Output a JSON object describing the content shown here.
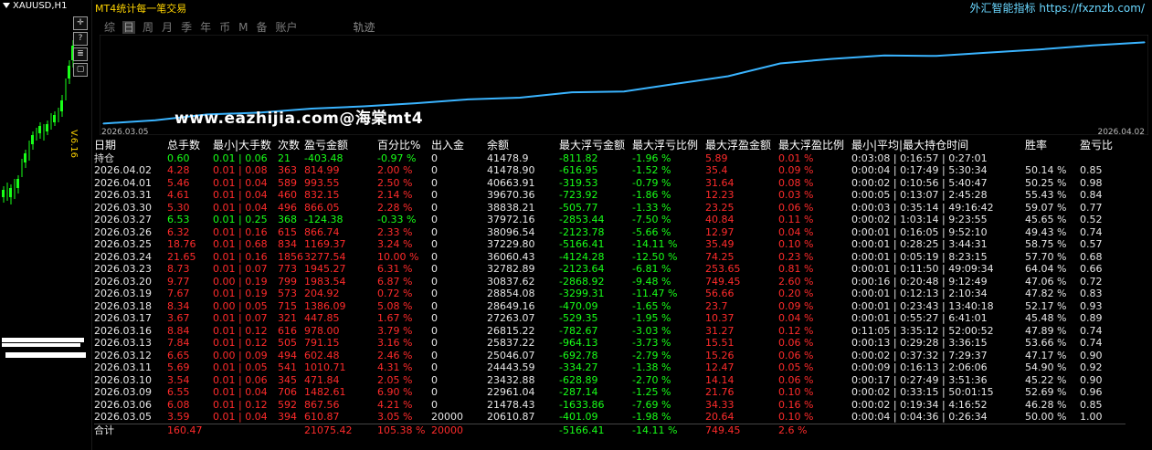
{
  "mt4": {
    "symbol": "XAUUSD,H1",
    "price_label": "V.6.16",
    "tool_icons": [
      "crosshair-icon",
      "help-icon",
      "settings-icon",
      "window-icon"
    ]
  },
  "panel": {
    "title": "MT4统计每一笔交易",
    "site": "外汇智能指标 https://fxznzb.com/",
    "tabs": [
      "综",
      "日",
      "周",
      "月",
      "季",
      "年",
      "币",
      "M",
      "备",
      "账户"
    ],
    "active_tab": "日",
    "track_tab": "轨迹",
    "date_start": "2026.03.05",
    "date_end": "2026.04.02",
    "watermark": "www.eazhijia.com@海棠mt4",
    "curve_color": "#3ab4ff"
  },
  "table": {
    "headers": [
      "日期",
      "总手数",
      "最小|大手数",
      "次数",
      "盈亏金额",
      "百分比%",
      "出入金",
      "余额",
      "最大浮亏金额",
      "最大浮亏比例",
      "最大浮盈金额",
      "最大浮盈比例",
      "最小|平均|最大持仓时间",
      "胜率",
      "盈亏比"
    ],
    "holding": [
      "持仓",
      "0.60",
      "0.01 | 0.06",
      "21",
      "-403.48",
      "-0.97 %",
      "0",
      "41478.9",
      "-811.82",
      "-1.96 %",
      "5.89",
      "0.01 %",
      "0:03:08 | 0:16:57 | 0:27:01",
      "",
      ""
    ],
    "rows": [
      [
        "2026.04.02",
        "4.28",
        "0.01 | 0.08",
        "363",
        "814.99",
        "2.00 %",
        "0",
        "41478.90",
        "-616.95",
        "-1.52 %",
        "35.4",
        "0.09 %",
        "0:00:04 | 0:17:49 | 5:30:34",
        "50.14 %",
        "0.85"
      ],
      [
        "2026.04.01",
        "5.46",
        "0.01 | 0.04",
        "589",
        "993.55",
        "2.50 %",
        "0",
        "40663.91",
        "-319.53",
        "-0.79 %",
        "31.64",
        "0.08 %",
        "0:00:02 | 0:10:56 | 5:40:47",
        "50.25 %",
        "0.98"
      ],
      [
        "2026.03.31",
        "4.61",
        "0.01 | 0.04",
        "460",
        "832.15",
        "2.14 %",
        "0",
        "39670.36",
        "-723.92",
        "-1.86 %",
        "12.23",
        "0.03 %",
        "0:00:05 | 0:13:07 | 2:45:28",
        "55.43 %",
        "0.84"
      ],
      [
        "2026.03.30",
        "5.30",
        "0.01 | 0.04",
        "496",
        "866.05",
        "2.28 %",
        "0",
        "38838.21",
        "-505.77",
        "-1.33 %",
        "23.25",
        "0.06 %",
        "0:00:03 | 0:35:14 | 49:16:42",
        "59.07 %",
        "0.77"
      ],
      [
        "2026.03.27",
        "6.53",
        "0.01 | 0.25",
        "368",
        "-124.38",
        "-0.33 %",
        "0",
        "37972.16",
        "-2853.44",
        "-7.50 %",
        "40.84",
        "0.11 %",
        "0:00:02 | 1:03:14 | 9:23:55",
        "45.65 %",
        "0.52"
      ],
      [
        "2026.03.26",
        "6.32",
        "0.01 | 0.16",
        "615",
        "866.74",
        "2.33 %",
        "0",
        "38096.54",
        "-2123.78",
        "-5.66 %",
        "12.97",
        "0.04 %",
        "0:00:01 | 0:16:05 | 9:52:10",
        "49.43 %",
        "0.74"
      ],
      [
        "2026.03.25",
        "18.76",
        "0.01 | 0.68",
        "834",
        "1169.37",
        "3.24 %",
        "0",
        "37229.80",
        "-5166.41",
        "-14.11 %",
        "35.49",
        "0.10 %",
        "0:00:01 | 0:28:25 | 3:44:31",
        "58.75 %",
        "0.57"
      ],
      [
        "2026.03.24",
        "21.65",
        "0.01 | 0.16",
        "1856",
        "3277.54",
        "10.00 %",
        "0",
        "36060.43",
        "-4124.28",
        "-12.50 %",
        "74.25",
        "0.23 %",
        "0:00:01 | 0:05:19 | 8:23:15",
        "57.70 %",
        "0.68"
      ],
      [
        "2026.03.23",
        "8.73",
        "0.01 | 0.07",
        "773",
        "1945.27",
        "6.31 %",
        "0",
        "32782.89",
        "-2123.64",
        "-6.81 %",
        "253.65",
        "0.81 %",
        "0:00:01 | 0:11:50 | 49:09:34",
        "64.04 %",
        "0.66"
      ],
      [
        "2026.03.20",
        "9.77",
        "0.00 | 0.19",
        "799",
        "1983.54",
        "6.87 %",
        "0",
        "30837.62",
        "-2868.92",
        "-9.48 %",
        "749.45",
        "2.60 %",
        "0:00:16 | 0:20:48 | 9:12:49",
        "47.06 %",
        "0.72"
      ],
      [
        "2026.03.19",
        "7.67",
        "0.01 | 0.19",
        "573",
        "204.92",
        "0.72 %",
        "0",
        "28854.08",
        "-3299.31",
        "-11.47 %",
        "56.66",
        "0.20 %",
        "0:00:01 | 0:12:13 | 2:10:34",
        "47.82 %",
        "0.83"
      ],
      [
        "2026.03.18",
        "8.34",
        "0.00 | 0.05",
        "715",
        "1386.09",
        "5.08 %",
        "0",
        "28649.16",
        "-470.09",
        "-1.65 %",
        "23.7",
        "0.09 %",
        "0:00:01 | 0:23:43 | 13:40:18",
        "52.17 %",
        "0.93"
      ],
      [
        "2026.03.17",
        "3.67",
        "0.01 | 0.07",
        "321",
        "447.85",
        "1.67 %",
        "0",
        "27263.07",
        "-529.35",
        "-1.95 %",
        "10.37",
        "0.04 %",
        "0:00:01 | 0:55:27 | 6:41:01",
        "45.48 %",
        "0.89"
      ],
      [
        "2026.03.16",
        "8.84",
        "0.01 | 0.12",
        "616",
        "978.00",
        "3.79 %",
        "0",
        "26815.22",
        "-782.67",
        "-3.03 %",
        "31.27",
        "0.12 %",
        "0:11:05 | 3:35:12 | 52:00:52",
        "47.89 %",
        "0.74"
      ],
      [
        "2026.03.13",
        "7.84",
        "0.01 | 0.12",
        "505",
        "791.15",
        "3.16 %",
        "0",
        "25837.22",
        "-964.13",
        "-3.73 %",
        "15.51",
        "0.06 %",
        "0:00:13 | 0:29:28 | 3:36:15",
        "53.66 %",
        "0.74"
      ],
      [
        "2026.03.12",
        "6.65",
        "0.00 | 0.09",
        "494",
        "602.48",
        "2.46 %",
        "0",
        "25046.07",
        "-692.78",
        "-2.79 %",
        "15.26",
        "0.06 %",
        "0:00:02 | 0:37:32 | 7:29:37",
        "47.17 %",
        "0.90"
      ],
      [
        "2026.03.11",
        "5.69",
        "0.01 | 0.05",
        "541",
        "1010.71",
        "4.31 %",
        "0",
        "24443.59",
        "-334.27",
        "-1.38 %",
        "12.47",
        "0.05 %",
        "0:00:09 | 0:16:13 | 2:06:06",
        "54.90 %",
        "0.92"
      ],
      [
        "2026.03.10",
        "3.54",
        "0.01 | 0.06",
        "345",
        "471.84",
        "2.05 %",
        "0",
        "23432.88",
        "-628.89",
        "-2.70 %",
        "14.14",
        "0.06 %",
        "0:00:17 | 0:27:49 | 3:51:36",
        "45.22 %",
        "0.90"
      ],
      [
        "2026.03.09",
        "6.55",
        "0.01 | 0.04",
        "706",
        "1482.61",
        "6.90 %",
        "0",
        "22961.04",
        "-287.14",
        "-1.25 %",
        "21.76",
        "0.10 %",
        "0:00:02 | 0:33:15 | 50:01:15",
        "52.69 %",
        "0.96"
      ],
      [
        "2026.03.06",
        "6.08",
        "0.01 | 0.12",
        "592",
        "867.56",
        "4.21 %",
        "0",
        "21478.43",
        "-1633.86",
        "-7.69 %",
        "34.33",
        "0.16 %",
        "0:00:02 | 0:19:34 | 4:16:52",
        "46.28 %",
        "0.85"
      ],
      [
        "2026.03.05",
        "3.59",
        "0.01 | 0.04",
        "394",
        "610.87",
        "3.05 %",
        "20000",
        "20610.87",
        "-401.09",
        "-1.98 %",
        "20.64",
        "0.10 %",
        "0:00:04 | 0:04:36 | 0:26:34",
        "50.00 %",
        "1.00"
      ]
    ],
    "total": [
      "合计",
      "160.47",
      "",
      "",
      "21075.42",
      "105.38 %",
      "20000",
      "",
      "-5166.41",
      "-14.11 %",
      "749.45",
      "2.6 %",
      "",
      "",
      ""
    ]
  },
  "chart_data": {
    "type": "line",
    "x": [
      "2026.03.05",
      "2026.03.06",
      "2026.03.09",
      "2026.03.10",
      "2026.03.11",
      "2026.03.12",
      "2026.03.13",
      "2026.03.16",
      "2026.03.17",
      "2026.03.18",
      "2026.03.19",
      "2026.03.20",
      "2026.03.23",
      "2026.03.24",
      "2026.03.25",
      "2026.03.26",
      "2026.03.27",
      "2026.03.30",
      "2026.03.31",
      "2026.04.01",
      "2026.04.02"
    ],
    "y": [
      20610.87,
      21478.43,
      22961.04,
      23432.88,
      24443.59,
      25046.07,
      25837.22,
      26815.22,
      27263.07,
      28649.16,
      28854.08,
      30837.62,
      32782.89,
      36060.43,
      37229.8,
      38096.54,
      37972.16,
      38838.21,
      39670.36,
      40663.91,
      41478.9
    ],
    "ylim": [
      20000,
      42500
    ]
  }
}
